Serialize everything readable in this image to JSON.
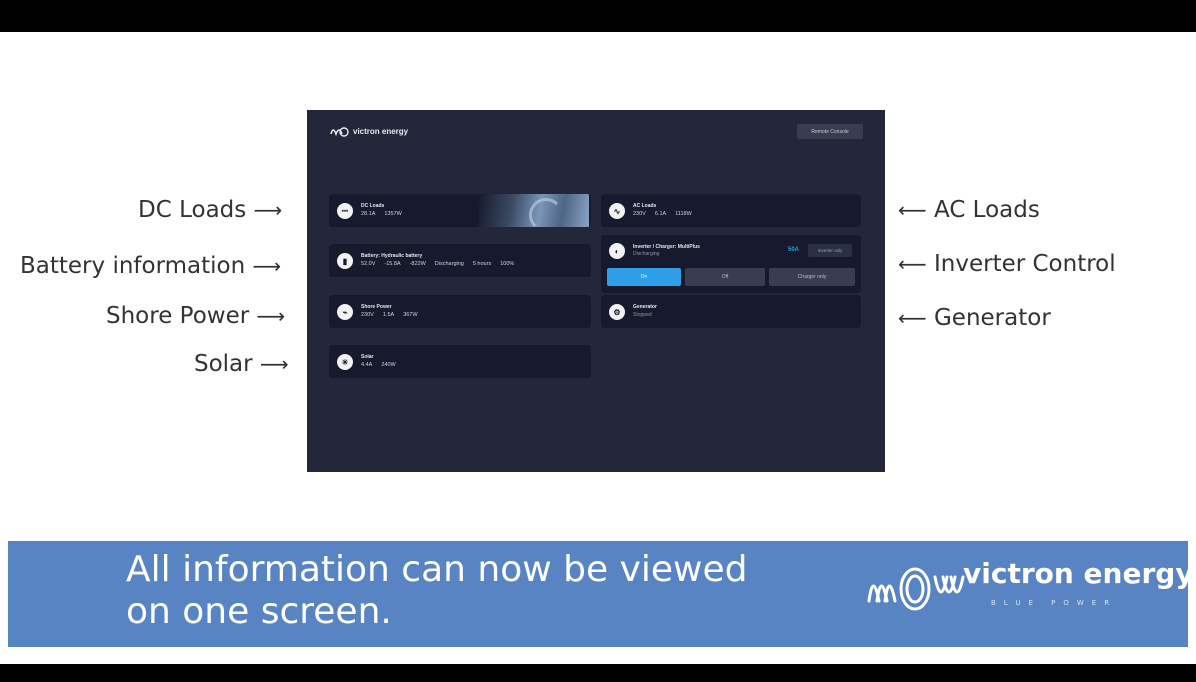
{
  "callouts": {
    "dc_loads": "DC Loads",
    "battery_information": "Battery information",
    "shore_power": "Shore Power",
    "solar": "Solar",
    "ac_loads": "AC Loads",
    "inverter_control": "Inverter Control",
    "generator": "Generator",
    "arrow_right": "⟶",
    "arrow_left": "⟵"
  },
  "screen": {
    "brand": "victron energy",
    "remote_console_label": "Remote Console",
    "dc_loads": {
      "title": "DC Loads",
      "current": "28.1A",
      "power": "1357W"
    },
    "battery": {
      "title": "Battery: Hydraulic battery",
      "voltage": "52.0V",
      "current": "-15.8A",
      "power": "-822W",
      "state": "Discharging",
      "time": "5 hours",
      "soc": "100%"
    },
    "shore_power": {
      "title": "Shore Power",
      "voltage": "230V",
      "current": "1.5A",
      "power": "367W"
    },
    "solar": {
      "title": "Solar",
      "current": "4.4A",
      "power": "240W"
    },
    "ac_loads": {
      "title": "AC Loads",
      "voltage": "230V",
      "current": "6.1A",
      "power": "1118W"
    },
    "inverter": {
      "title": "Inverter / Charger: MultiPlus",
      "state": "Discharging",
      "soc": "50A",
      "mode_pill": "Inverter only",
      "btn_on": "On",
      "btn_off": "Off",
      "btn_charger_only": "Charger only"
    },
    "generator": {
      "title": "Generator",
      "state": "Stopped"
    }
  },
  "banner": {
    "line1": "All information can now be viewed",
    "line2": "on one screen.",
    "brand_name": "victron energy",
    "brand_tagline": "BLUE POWER"
  },
  "colors": {
    "banner": "#5884c4",
    "screen_bg": "#24273a",
    "tile_bg": "#171a2c",
    "accent": "#2f9ee8"
  }
}
